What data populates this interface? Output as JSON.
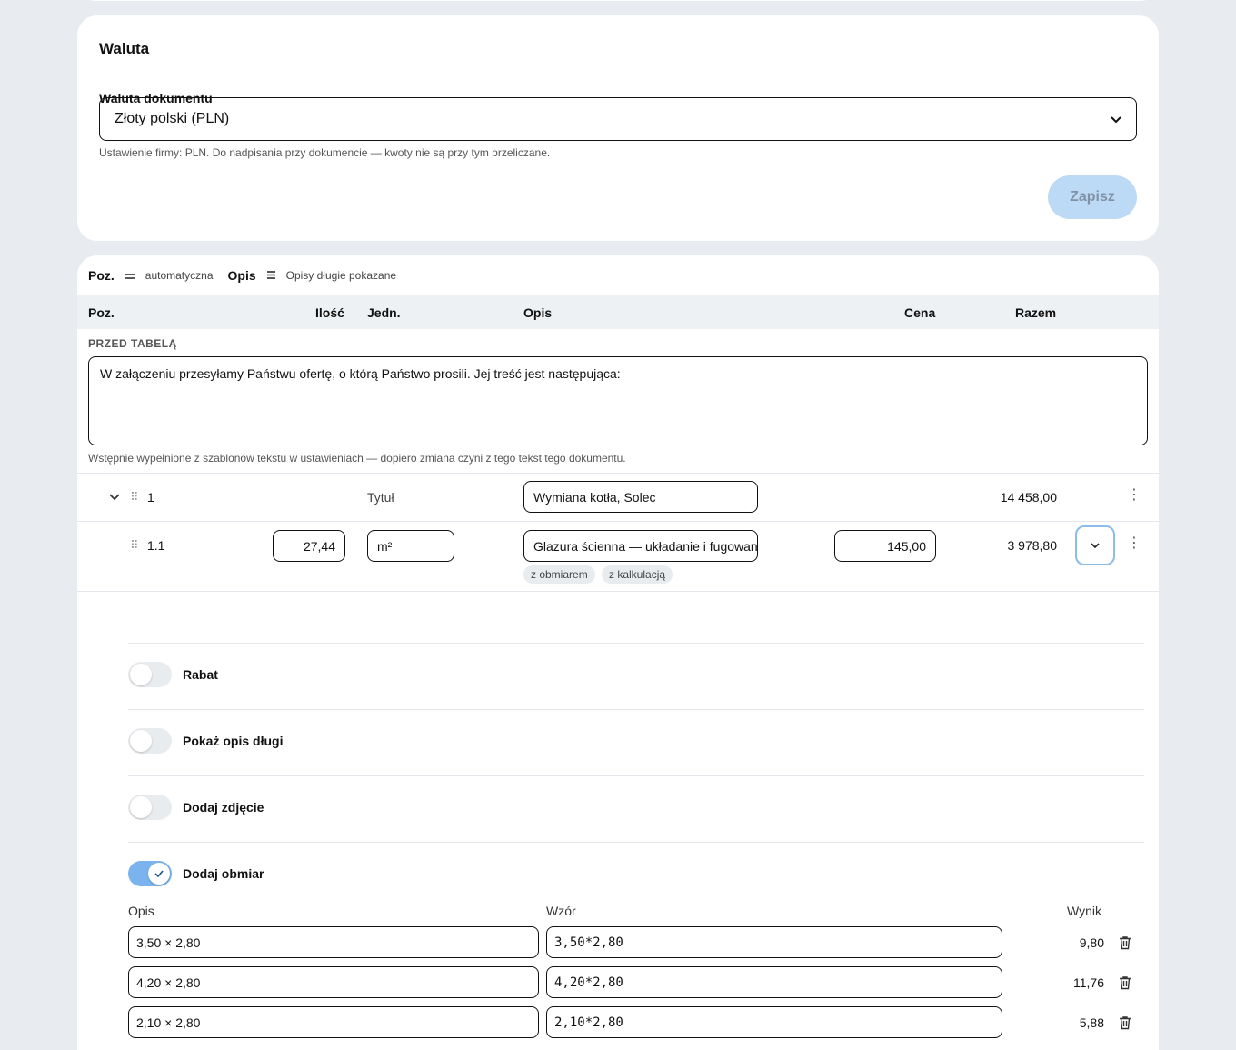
{
  "currency": {
    "title": "Waluta",
    "field_label": "Waluta dokumentu",
    "selected": "Złoty polski (PLN)",
    "helper": "Ustawienie firmy: PLN. Do nadpisania przy dokumencie — kwoty nie są przy tym przeliczane.",
    "save_label": "Zapisz"
  },
  "toolbar": {
    "poz_label": "Poz.",
    "poz_value": "automatyczna",
    "opis_label": "Opis",
    "opis_value": "Opisy długie pokazane"
  },
  "table_header": {
    "poz": "Poz.",
    "ilosc": "Ilość",
    "jedn": "Jedn.",
    "opis": "Opis",
    "cena": "Cena",
    "razem": "Razem"
  },
  "before_table": {
    "label": "PRZED TABELĄ",
    "text": "W załączeniu przesyłamy Państwu ofertę, o którą Państwo prosili. Jej treść jest następująca:",
    "helper": "Wstępnie wypełnione z szablonów tekstu w ustawieniach — dopiero zmiana czyni z tego tekst tego dokumentu."
  },
  "rows": [
    {
      "num": "1",
      "unit": "Tytuł",
      "desc": "Wymiana kotła, Solec",
      "total": "14 458,00"
    },
    {
      "num": "1.1",
      "qty": "27,44",
      "unit": "m²",
      "desc": "Glazura ścienna — układanie i fugowanie",
      "price": "145,00",
      "total": "3 978,80",
      "chips": [
        "z obmiarem",
        "z kalkulacją"
      ]
    }
  ],
  "options": [
    {
      "label": "Rabat",
      "on": false
    },
    {
      "label": "Pokaż opis długi",
      "on": false
    },
    {
      "label": "Dodaj zdjęcie",
      "on": false
    },
    {
      "label": "Dodaj obmiar",
      "on": true
    }
  ],
  "measurement": {
    "col_opis": "Opis",
    "col_wzor": "Wzór",
    "col_wynik": "Wynik",
    "rows": [
      {
        "opis": "3,50 × 2,80",
        "wzor": "3,50*2,80",
        "wynik": "9,80"
      },
      {
        "opis": "4,20 × 2,80",
        "wzor": "4,20*2,80",
        "wynik": "11,76"
      },
      {
        "opis": "2,10 × 2,80",
        "wzor": "2,10*2,80",
        "wynik": "5,88"
      }
    ]
  },
  "colors": {
    "accent_light": "#bcd9f5",
    "toggle_on": "#7ab3ee",
    "focus_border": "#8cbcea"
  },
  "icons": [
    "chevron-down-icon",
    "drag-handle-icon",
    "kebab-menu-icon",
    "check-icon",
    "trash-icon",
    "equals-icon",
    "menu-lines-icon"
  ]
}
